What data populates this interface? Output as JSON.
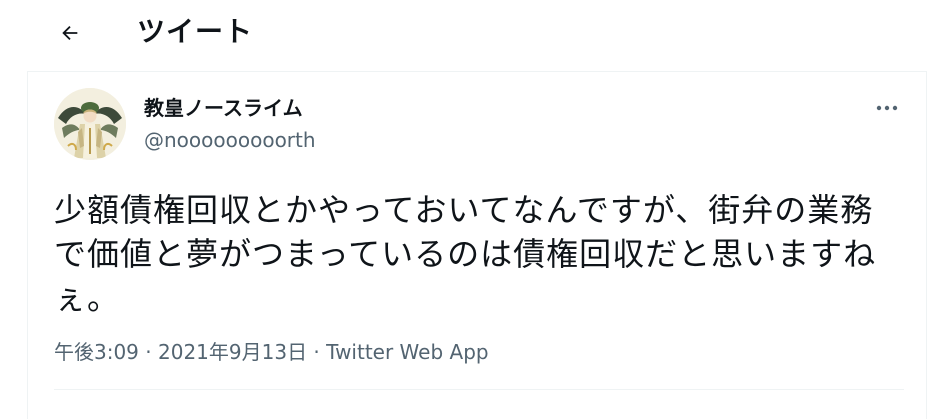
{
  "header": {
    "back_icon": "arrow-left-icon",
    "title": "ツイート"
  },
  "tweet": {
    "author": {
      "display_name": "教皇ノースライム",
      "handle": "@nooooooooorth",
      "avatar": "anime-character-avatar"
    },
    "more_icon": "more-dots-icon",
    "text": "少額債権回収とかやっておいてなんですが、街弁の業務で価値と夢がつまっているのは債権回収だと思いますねぇ。",
    "time": "午後3:09",
    "separator": " · ",
    "date": "2021年9月13日",
    "source": "Twitter Web App"
  },
  "colors": {
    "text": "#0f1419",
    "secondary": "#536471",
    "border": "#eff3f4"
  }
}
